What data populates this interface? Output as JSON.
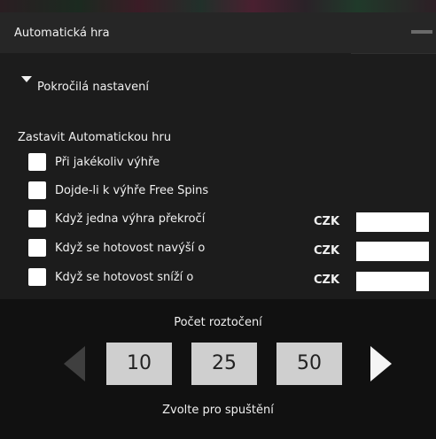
{
  "header": {
    "title": "Automatická hra"
  },
  "advanced": {
    "label": "Pokročilá nastavení"
  },
  "stop": {
    "title": "Zastavit Automatickou hru",
    "options": [
      {
        "label": "Při jakékoliv výhře"
      },
      {
        "label": "Dojde-li k výhře Free Spins"
      },
      {
        "label": "Když jedna výhra překročí",
        "currency": "CZK",
        "value": ""
      },
      {
        "label": "Když se hotovost navýší o",
        "currency": "CZK",
        "value": ""
      },
      {
        "label": "Když se hotovost sníží o",
        "currency": "CZK",
        "value": ""
      }
    ]
  },
  "spins": {
    "title": "Počet roztočení",
    "options": [
      "10",
      "25",
      "50"
    ],
    "hint": "Zvolte pro spuštění"
  },
  "colors": {
    "panel": "#1c1c1c",
    "header": "#262626",
    "bottom": "#111111",
    "option_button": "#cfcfcf",
    "arrow_disabled": "#3f3f3f",
    "arrow_enabled": "#f5f5f5"
  },
  "icons": {
    "collapse": "triangle-down-icon",
    "minimize": "minimize-icon",
    "prev": "arrow-left-icon",
    "next": "arrow-right-icon"
  }
}
